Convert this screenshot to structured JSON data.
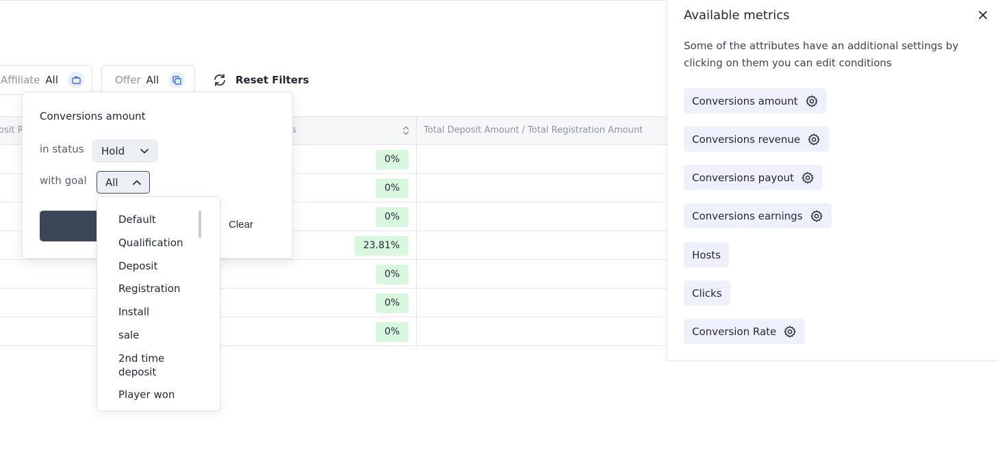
{
  "filters": {
    "affiliate": {
      "key": "Affiliate",
      "value": "All",
      "icon": "briefcase-icon"
    },
    "offer": {
      "key": "Offer",
      "value": "All",
      "icon": "copy-icon"
    },
    "reset_label": "Reset Filters"
  },
  "table": {
    "header_partial_left": "osit R",
    "header_partial_mid": "s",
    "header_col": "Total Deposit Amount / Total Registration Amount",
    "rows": [
      "0%",
      "0%",
      "0%",
      "23.81%",
      "0%",
      "0%",
      "0%"
    ],
    "pill_color": "#d8f7de"
  },
  "popover": {
    "title": "Conversions amount",
    "status_label": "in status",
    "status_value": "Hold",
    "goal_label": "with goal",
    "goal_value": "All",
    "clear_label": "Clear"
  },
  "goal_options": [
    "Default",
    "Qualification",
    "Deposit",
    "Registration",
    "Install",
    "sale",
    "2nd time deposit",
    "Player won"
  ],
  "panel": {
    "title": "Available metrics",
    "description": "Some of the attributes have an additional settings by clicking on them you can edit conditions",
    "metrics": [
      {
        "label": "Conversions amount",
        "settings": true
      },
      {
        "label": "Conversions revenue",
        "settings": true
      },
      {
        "label": "Conversions payout",
        "settings": true
      },
      {
        "label": "Conversions earnings",
        "settings": true
      },
      {
        "label": "Hosts",
        "settings": false
      },
      {
        "label": "Clicks",
        "settings": false
      },
      {
        "label": "Conversion Rate",
        "settings": true
      }
    ]
  },
  "colors": {
    "accent": "#3a4759",
    "chip_bg": "#eef1fb"
  }
}
